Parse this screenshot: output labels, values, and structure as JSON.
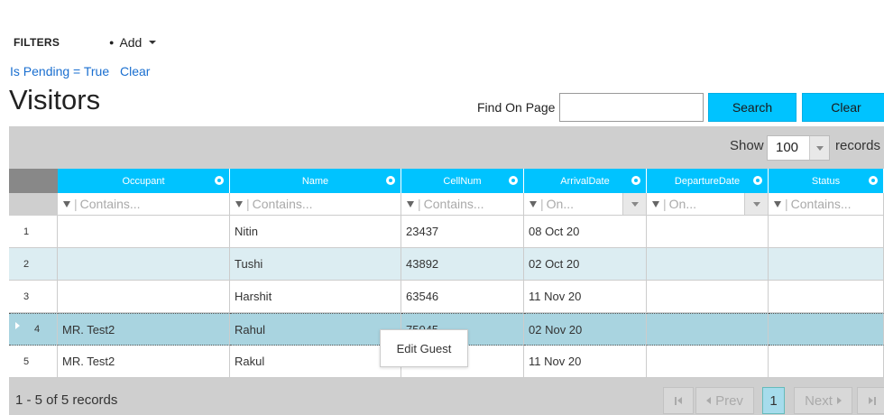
{
  "filters": {
    "label": "FILTERS",
    "add_label": "Add",
    "active_filter": "Is Pending = True",
    "clear_label": "Clear"
  },
  "page_title": "Visitors",
  "find": {
    "label": "Find On Page",
    "value": "",
    "search_label": "Search",
    "clear_label": "Clear"
  },
  "grid": {
    "show_label": "Show",
    "page_size": "100",
    "records_label": "records",
    "columns": [
      {
        "label": "Occupant",
        "filter_placeholder": "Contains..."
      },
      {
        "label": "Name",
        "filter_placeholder": "Contains..."
      },
      {
        "label": "CellNum",
        "filter_placeholder": "Contains..."
      },
      {
        "label": "ArrivalDate",
        "filter_placeholder": "On..."
      },
      {
        "label": "DepartureDate",
        "filter_placeholder": "On..."
      },
      {
        "label": "Status",
        "filter_placeholder": "Contains..."
      }
    ],
    "rows": [
      {
        "num": "1",
        "occupant": "",
        "name": "Nitin",
        "cell": "23437",
        "arrival": "08 Oct 20",
        "departure": "",
        "status": ""
      },
      {
        "num": "2",
        "occupant": "",
        "name": "Tushi",
        "cell": "43892",
        "arrival": "02 Oct 20",
        "departure": "",
        "status": ""
      },
      {
        "num": "3",
        "occupant": "",
        "name": "Harshit",
        "cell": "63546",
        "arrival": "11 Nov 20",
        "departure": "",
        "status": ""
      },
      {
        "num": "4",
        "occupant": "MR. Test2",
        "name": "Rahul",
        "cell": "75045",
        "arrival": "02 Nov 20",
        "departure": "",
        "status": ""
      },
      {
        "num": "5",
        "occupant": "MR. Test2",
        "name": "Rakul",
        "cell": "",
        "arrival": "11 Nov 20",
        "departure": "",
        "status": ""
      }
    ],
    "selected_row": "4"
  },
  "context_menu": {
    "item": "Edit Guest"
  },
  "pager": {
    "info": "1 - 5 of 5 records",
    "prev_label": "Prev",
    "current_page": "1",
    "next_label": "Next"
  },
  "colors": {
    "accent": "#00c3ff",
    "row_alt": "#dcedf2",
    "row_selected": "#a9d4e0",
    "link": "#1a6fd0"
  }
}
